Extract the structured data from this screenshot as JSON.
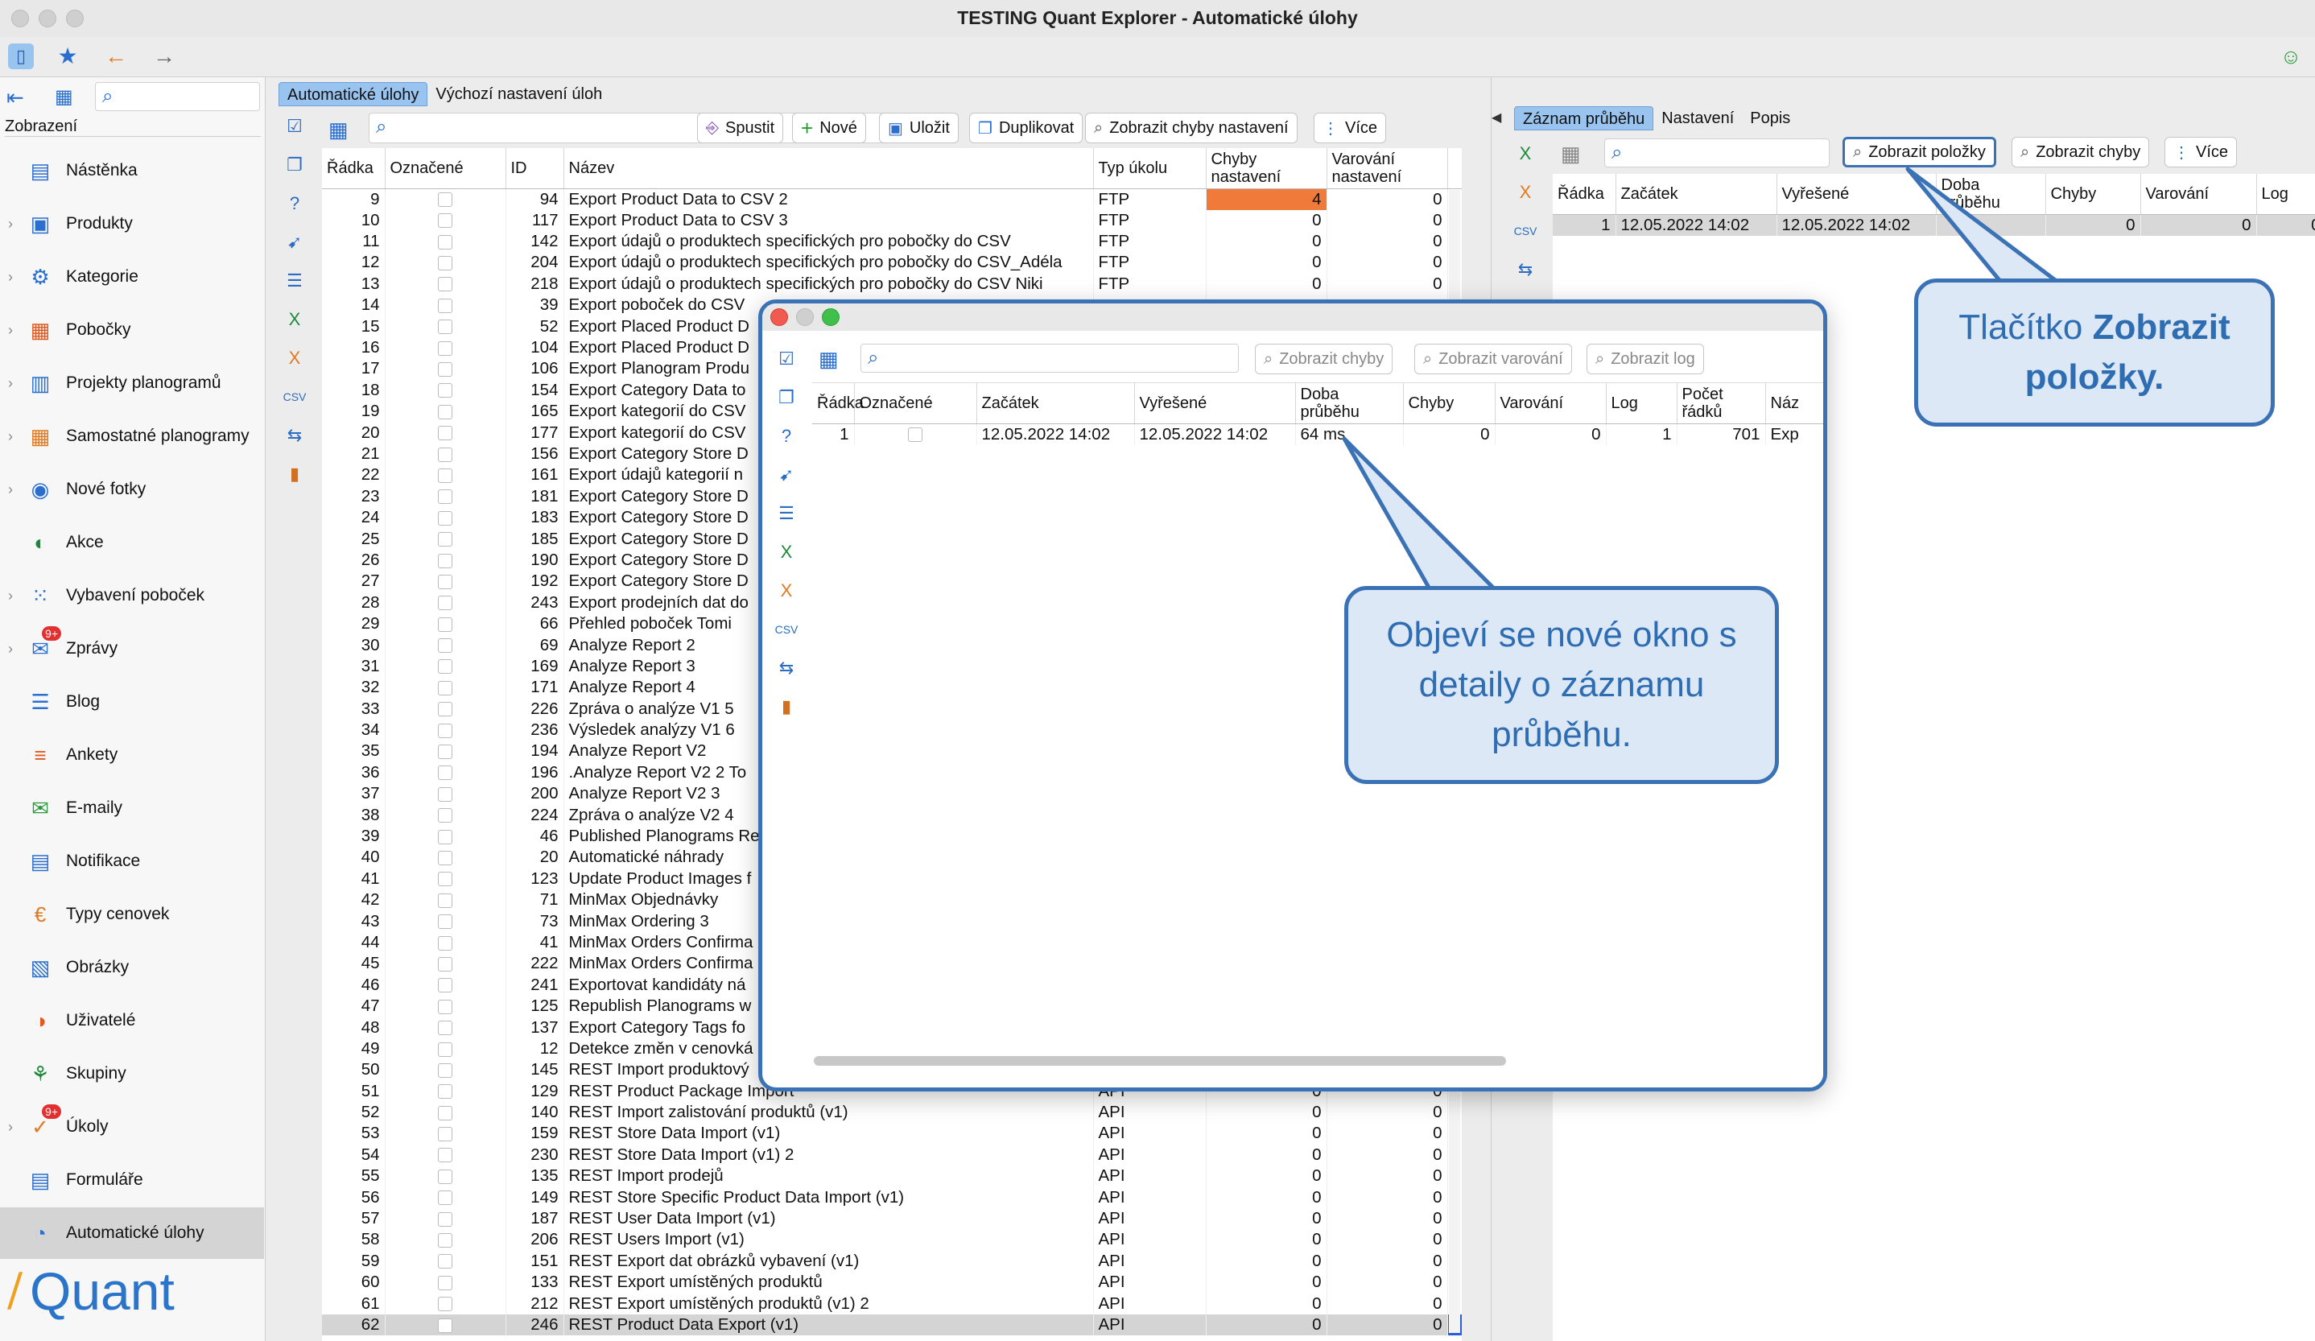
{
  "window": {
    "title": "TESTING Quant Explorer - Automatické úlohy"
  },
  "sidebar": {
    "header": "Zobrazení",
    "items": [
      {
        "label": "Nástěnka",
        "icon": "dashboard-icon",
        "chev": false
      },
      {
        "label": "Produkty",
        "icon": "product-icon",
        "chev": true
      },
      {
        "label": "Kategorie",
        "icon": "category-icon",
        "chev": true
      },
      {
        "label": "Pobočky",
        "icon": "store-icon",
        "chev": true
      },
      {
        "label": "Projekty planogramů",
        "icon": "planogram-project-icon",
        "chev": true
      },
      {
        "label": "Samostatné planogramy",
        "icon": "planogram-icon",
        "chev": true
      },
      {
        "label": "Nové fotky",
        "icon": "camera-icon",
        "chev": true
      },
      {
        "label": "Akce",
        "icon": "promo-icon",
        "chev": false
      },
      {
        "label": "Vybavení poboček",
        "icon": "equipment-icon",
        "chev": true
      },
      {
        "label": "Zprávy",
        "icon": "messages-icon",
        "chev": true,
        "badge": "9+"
      },
      {
        "label": "Blog",
        "icon": "blog-icon",
        "chev": false
      },
      {
        "label": "Ankety",
        "icon": "survey-icon",
        "chev": false
      },
      {
        "label": "E-maily",
        "icon": "email-icon",
        "chev": false
      },
      {
        "label": "Notifikace",
        "icon": "notification-icon",
        "chev": false
      },
      {
        "label": "Typy cenovek",
        "icon": "price-tag-icon",
        "chev": false
      },
      {
        "label": "Obrázky",
        "icon": "image-icon",
        "chev": false
      },
      {
        "label": "Uživatelé",
        "icon": "user-icon",
        "chev": false
      },
      {
        "label": "Skupiny",
        "icon": "group-icon",
        "chev": false
      },
      {
        "label": "Úkoly",
        "icon": "task-icon",
        "chev": true,
        "badge": "9+"
      },
      {
        "label": "Formuláře",
        "icon": "form-icon",
        "chev": false
      },
      {
        "label": "Automatické úlohy",
        "icon": "automation-icon",
        "chev": false,
        "selected": true
      }
    ],
    "logo": "Quant"
  },
  "main": {
    "tabs": [
      "Automatické úlohy",
      "Výchozí nastavení úloh"
    ],
    "buttons": {
      "run": "Spustit",
      "new": "Nové",
      "save": "Uložit",
      "duplicate": "Duplikovat",
      "show_errors": "Zobrazit chyby nastavení",
      "more": "Více"
    },
    "columns": [
      "Řádka",
      "Označené",
      "ID",
      "Název",
      "Typ úkolu",
      "Chyby nastavení",
      "Varování nastavení"
    ],
    "rows": [
      [
        "9",
        "94",
        "Export Product Data to CSV 2",
        "FTP",
        "4",
        "0"
      ],
      [
        "10",
        "117",
        "Export Product Data to CSV 3",
        "FTP",
        "0",
        "0"
      ],
      [
        "11",
        "142",
        "Export údajů o produktech specifických pro pobočky do CSV",
        "FTP",
        "0",
        "0"
      ],
      [
        "12",
        "204",
        "Export údajů o produktech specifických pro pobočky do CSV_Adéla",
        "FTP",
        "0",
        "0"
      ],
      [
        "13",
        "218",
        "Export údajů o produktech specifických pro pobočky do CSV Niki",
        "FTP",
        "0",
        "0"
      ],
      [
        "14",
        "39",
        "Export poboček do CSV",
        "",
        "",
        ""
      ],
      [
        "15",
        "52",
        "Export Placed Product D",
        "",
        "",
        ""
      ],
      [
        "16",
        "104",
        "Export Placed Product D",
        "",
        "",
        ""
      ],
      [
        "17",
        "106",
        "Export Planogram Produ",
        "",
        "",
        ""
      ],
      [
        "18",
        "154",
        "Export Category Data to",
        "",
        "",
        ""
      ],
      [
        "19",
        "165",
        "Export kategorií do CSV",
        "",
        "",
        ""
      ],
      [
        "20",
        "177",
        "Export kategorií do CSV",
        "",
        "",
        ""
      ],
      [
        "21",
        "156",
        "Export Category Store D",
        "",
        "",
        ""
      ],
      [
        "22",
        "161",
        "Export údajů kategorií n",
        "",
        "",
        ""
      ],
      [
        "23",
        "181",
        "Export Category Store D",
        "",
        "",
        ""
      ],
      [
        "24",
        "183",
        "Export Category Store D",
        "",
        "",
        ""
      ],
      [
        "25",
        "185",
        "Export Category Store D",
        "",
        "",
        ""
      ],
      [
        "26",
        "190",
        "Export Category Store D",
        "",
        "",
        ""
      ],
      [
        "27",
        "192",
        "Export Category Store D",
        "",
        "",
        ""
      ],
      [
        "28",
        "243",
        "Export prodejních dat do",
        "",
        "",
        ""
      ],
      [
        "29",
        "66",
        "Přehled poboček Tomi",
        "",
        "",
        ""
      ],
      [
        "30",
        "69",
        "Analyze Report 2",
        "",
        "",
        ""
      ],
      [
        "31",
        "169",
        "Analyze Report 3",
        "",
        "",
        ""
      ],
      [
        "32",
        "171",
        "Analyze Report 4",
        "",
        "",
        ""
      ],
      [
        "33",
        "226",
        "Zpráva o analýze V1 5",
        "",
        "",
        ""
      ],
      [
        "34",
        "236",
        "Výsledek analýzy V1 6",
        "",
        "",
        ""
      ],
      [
        "35",
        "194",
        "Analyze Report V2",
        "",
        "",
        ""
      ],
      [
        "36",
        "196",
        ".Analyze Report V2 2 To",
        "",
        "",
        ""
      ],
      [
        "37",
        "200",
        "Analyze Report V2 3",
        "",
        "",
        ""
      ],
      [
        "38",
        "224",
        "Zpráva o analýze V2 4",
        "",
        "",
        ""
      ],
      [
        "39",
        "46",
        "Published Planograms Re",
        "",
        "",
        ""
      ],
      [
        "40",
        "20",
        "Automatické náhrady",
        "",
        "",
        ""
      ],
      [
        "41",
        "123",
        "Update Product Images f",
        "",
        "",
        ""
      ],
      [
        "42",
        "71",
        "MinMax Objednávky",
        "",
        "",
        ""
      ],
      [
        "43",
        "73",
        "MinMax Ordering 3",
        "",
        "",
        ""
      ],
      [
        "44",
        "41",
        "MinMax Orders Confirma",
        "",
        "",
        ""
      ],
      [
        "45",
        "222",
        "MinMax Orders Confirma",
        "",
        "",
        ""
      ],
      [
        "46",
        "241",
        "Exportovat kandidáty ná",
        "",
        "",
        ""
      ],
      [
        "47",
        "125",
        "Republish Planograms w",
        "",
        "",
        ""
      ],
      [
        "48",
        "137",
        "Export Category Tags fo",
        "",
        "",
        ""
      ],
      [
        "49",
        "12",
        "Detekce změn v cenovká",
        "",
        "",
        ""
      ],
      [
        "50",
        "145",
        "REST Import produktový",
        "",
        "",
        ""
      ],
      [
        "51",
        "129",
        "REST Product Package Import",
        "API",
        "0",
        "0"
      ],
      [
        "52",
        "140",
        "REST Import zalistování produktů (v1)",
        "API",
        "0",
        "0"
      ],
      [
        "53",
        "159",
        "REST Store Data Import (v1)",
        "API",
        "0",
        "0"
      ],
      [
        "54",
        "230",
        "REST Store Data Import (v1) 2",
        "API",
        "0",
        "0"
      ],
      [
        "55",
        "135",
        "REST Import prodejů",
        "API",
        "0",
        "0"
      ],
      [
        "56",
        "149",
        "REST Store Specific Product Data Import (v1)",
        "API",
        "0",
        "0"
      ],
      [
        "57",
        "187",
        "REST User Data Import (v1)",
        "API",
        "0",
        "0"
      ],
      [
        "58",
        "206",
        "REST Users Import (v1)",
        "API",
        "0",
        "0"
      ],
      [
        "59",
        "151",
        "REST Export dat obrázků vybavení (v1)",
        "API",
        "0",
        "0"
      ],
      [
        "60",
        "133",
        "REST Export umístěných produktů",
        "API",
        "0",
        "0"
      ],
      [
        "61",
        "212",
        "REST Export umístěných produktů (v1) 2",
        "API",
        "0",
        "0"
      ],
      [
        "62",
        "246",
        "REST Product Data Export (v1)",
        "API",
        "0",
        "0"
      ]
    ]
  },
  "right": {
    "tabs": [
      "Záznam průběhu",
      "Nastavení",
      "Popis"
    ],
    "buttons": {
      "show_items": "Zobrazit položky",
      "show_errors": "Zobrazit chyby",
      "more": "Více"
    },
    "columns": [
      "Řádka",
      "Začátek",
      "Vyřešené",
      "Doba průběhu",
      "Chyby",
      "Varování",
      "Log"
    ],
    "row": [
      "1",
      "12.05.2022 14:02",
      "12.05.2022 14:02",
      "",
      "0",
      "0",
      "0"
    ]
  },
  "popup": {
    "buttons": {
      "show_errors": "Zobrazit chyby",
      "show_warnings": "Zobrazit varování",
      "show_log": "Zobrazit log"
    },
    "columns": [
      "Řádka",
      "Označené",
      "Začátek",
      "Vyřešené",
      "Doba průběhu",
      "Chyby",
      "Varování",
      "Log",
      "Počet řádků",
      "Náz"
    ],
    "row": [
      "1",
      "12.05.2022 14:02",
      "12.05.2022 14:02",
      "64 ms",
      "0",
      "0",
      "1",
      "701",
      "Exp"
    ]
  },
  "callouts": {
    "button": {
      "prefix": "Tlačítko ",
      "bold": "Zobrazit položky."
    },
    "window": "Objeví se nové okno s detaily o záznamu průběhu."
  },
  "colors": {
    "accent": "#3a72b5",
    "error_cell": "#f07a3a",
    "selection": "#9ac4f0",
    "callout_bg": "#dce8f6"
  }
}
